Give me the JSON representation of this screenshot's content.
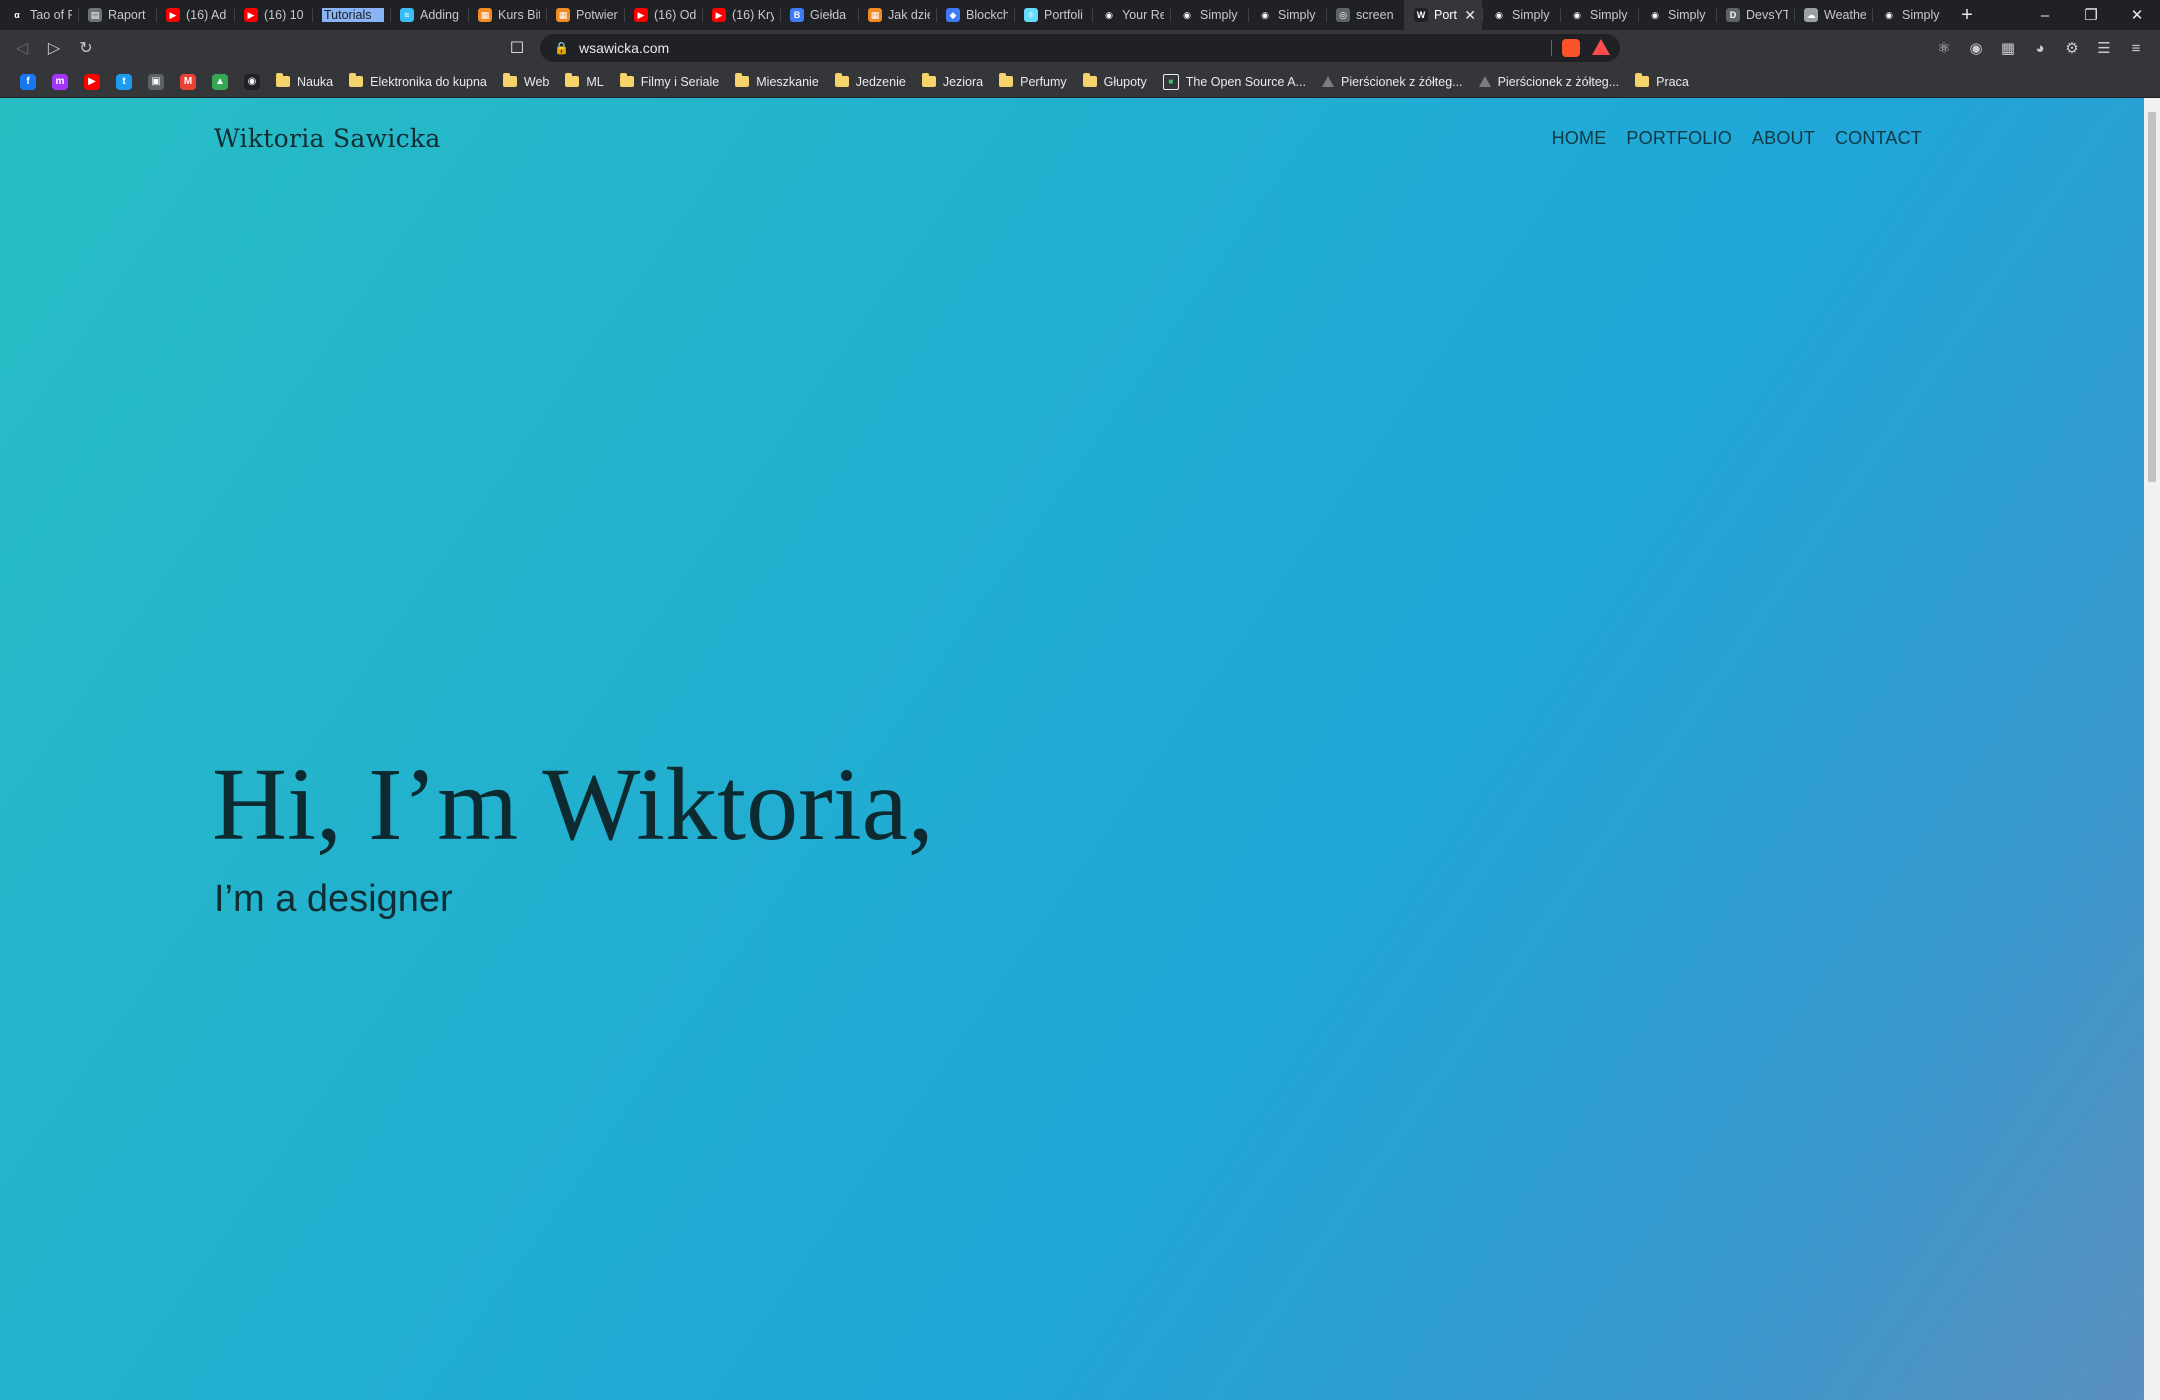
{
  "browser": {
    "tabs": [
      {
        "label": "Tao of R",
        "icon": "alpha-icon",
        "color": "#202124"
      },
      {
        "label": "Raport",
        "icon": "doc-icon",
        "color": "#6f7378"
      },
      {
        "label": "(16) Ad",
        "icon": "youtube-icon",
        "color": "#ff0000"
      },
      {
        "label": "(16) 10",
        "icon": "youtube-icon",
        "color": "#ff0000"
      },
      {
        "label": "Tutorials",
        "icon": "none",
        "color": "#202124",
        "highlight": true
      },
      {
        "label": "Adding",
        "icon": "tailwind-icon",
        "color": "#38bdf8"
      },
      {
        "label": "Kurs Bit",
        "icon": "course-icon",
        "color": "#f28b25"
      },
      {
        "label": "Potwier",
        "icon": "calendar-icon",
        "color": "#f28b25"
      },
      {
        "label": "(16) Od",
        "icon": "youtube-icon",
        "color": "#ff0000"
      },
      {
        "label": "(16) Kry",
        "icon": "youtube-icon",
        "color": "#ff0000"
      },
      {
        "label": "Giełda",
        "icon": "exchange-icon",
        "color": "#3d7bf7"
      },
      {
        "label": "Jak dzie",
        "icon": "calendar-icon",
        "color": "#f28b25"
      },
      {
        "label": "Blockch",
        "icon": "blockchain-icon",
        "color": "#3d7bf7"
      },
      {
        "label": "Portfoli",
        "icon": "react-icon",
        "color": "#61dafb"
      },
      {
        "label": "Your Re",
        "icon": "github-icon",
        "color": "#202124"
      },
      {
        "label": "Simply",
        "icon": "github-icon",
        "color": "#202124"
      },
      {
        "label": "Simply",
        "icon": "github-icon",
        "color": "#202124"
      },
      {
        "label": "screen",
        "icon": "globe-icon",
        "color": "#5f6368"
      },
      {
        "label": "Port",
        "icon": "wordpress-icon",
        "color": "#202124",
        "active": true
      },
      {
        "label": "Simply",
        "icon": "github-icon",
        "color": "#202124"
      },
      {
        "label": "Simply",
        "icon": "github-icon",
        "color": "#202124"
      },
      {
        "label": "Simply",
        "icon": "github-icon",
        "color": "#202124"
      },
      {
        "label": "DevsYT",
        "icon": "devs-icon",
        "color": "#5f6368"
      },
      {
        "label": "Weathe",
        "icon": "cloud-icon",
        "color": "#9aa0a6"
      },
      {
        "label": "Simply",
        "icon": "github-icon",
        "color": "#202124"
      }
    ],
    "url": "wsawicka.com",
    "bookmark_icons": [
      {
        "name": "facebook-icon",
        "color": "#1877f2"
      },
      {
        "name": "messenger-icon",
        "color": "#a334fa"
      },
      {
        "name": "youtube-icon",
        "color": "#ff0000"
      },
      {
        "name": "twitter-icon",
        "color": "#1d9bf0"
      },
      {
        "name": "image-icon",
        "color": "#5f6368"
      },
      {
        "name": "gmail-icon",
        "color": "#ea4335"
      },
      {
        "name": "drive-icon",
        "color": "#34a853"
      },
      {
        "name": "github-icon",
        "color": "#202124"
      }
    ],
    "bookmarks": [
      {
        "label": "Nauka",
        "type": "folder"
      },
      {
        "label": "Elektronika do kupna",
        "type": "folder"
      },
      {
        "label": "Web",
        "type": "folder"
      },
      {
        "label": "ML",
        "type": "folder"
      },
      {
        "label": "Filmy i Seriale",
        "type": "folder"
      },
      {
        "label": "Mieszkanie",
        "type": "folder"
      },
      {
        "label": "Jedzenie",
        "type": "folder"
      },
      {
        "label": "Jeziora",
        "type": "folder"
      },
      {
        "label": "Perfumy",
        "type": "folder"
      },
      {
        "label": "Głupoty",
        "type": "folder"
      },
      {
        "label": "The Open Source A...",
        "type": "site"
      },
      {
        "label": "Pierścionek z żółteg...",
        "type": "link"
      },
      {
        "label": "Pierścionek z żółteg...",
        "type": "link"
      },
      {
        "label": "Praca",
        "type": "folder"
      }
    ]
  },
  "site": {
    "title": "Wiktoria Sawicka",
    "nav": [
      "HOME",
      "PORTFOLIO",
      "ABOUT",
      "CONTACT"
    ],
    "hero_title": "Hi, I’m Wiktoria,",
    "hero_subtitle": "I’m a designer"
  }
}
